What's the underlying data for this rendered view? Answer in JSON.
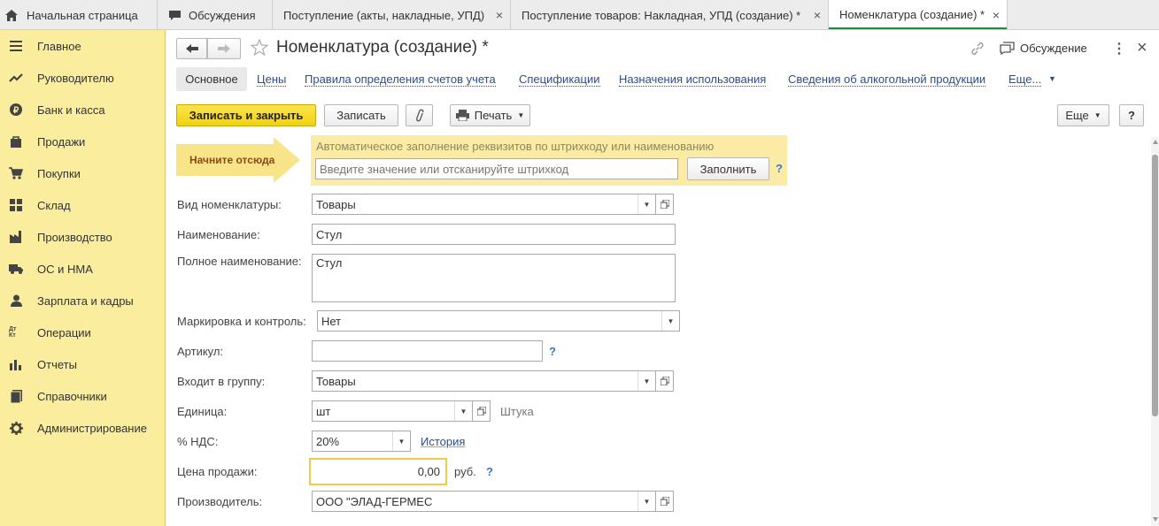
{
  "tabs": [
    {
      "label": "Начальная страница",
      "icon": "home-icon"
    },
    {
      "label": "Обсуждения",
      "icon": "chat-icon"
    },
    {
      "label": "Поступление (акты, накладные, УПД)",
      "close": "×"
    },
    {
      "label": "Поступление товаров: Накладная, УПД (создание) *",
      "close": "×"
    },
    {
      "label": "Номенклатура (создание) *",
      "close": "×"
    }
  ],
  "sidebar": {
    "items": [
      {
        "label": "Главное",
        "icon": "menu-icon"
      },
      {
        "label": "Руководителю",
        "icon": "trend-icon"
      },
      {
        "label": "Банк и касса",
        "icon": "coin-icon"
      },
      {
        "label": "Продажи",
        "icon": "bag-icon"
      },
      {
        "label": "Покупки",
        "icon": "cart-icon"
      },
      {
        "label": "Склад",
        "icon": "grid-icon"
      },
      {
        "label": "Производство",
        "icon": "factory-icon"
      },
      {
        "label": "ОС и НМА",
        "icon": "truck-icon"
      },
      {
        "label": "Зарплата и кадры",
        "icon": "person-icon"
      },
      {
        "label": "Операции",
        "icon": "dt-kt-icon",
        "glyph": "Дт Кт"
      },
      {
        "label": "Отчеты",
        "icon": "bar-chart-icon"
      },
      {
        "label": "Справочники",
        "icon": "book-icon"
      },
      {
        "label": "Администрирование",
        "icon": "gear-icon"
      }
    ]
  },
  "header": {
    "title": "Номенклатура (создание) *",
    "discussion": "Обсуждение",
    "more": "⋮",
    "close": "×"
  },
  "nav": {
    "main": "Основное",
    "links": [
      "Цены",
      "Правила определения счетов учета",
      "Спецификации",
      "Назначения использования",
      "Сведения об алкогольной продукции",
      "Еще..."
    ]
  },
  "toolbar": {
    "save_close": "Записать и закрыть",
    "save": "Записать",
    "print": "Печать",
    "more": "Еще",
    "help": "?"
  },
  "autofill": {
    "start_label": "Начните отсюда",
    "title": "Автоматическое заполнение реквизитов по штрихкоду или наименованию",
    "placeholder": "Введите значение или отсканируйте штрихкод",
    "fill_button": "Заполнить",
    "help": "?"
  },
  "form": {
    "kind_label": "Вид номенклатуры:",
    "kind_value": "Товары",
    "name_label": "Наименование:",
    "name_value": "Стул",
    "full_name_label": "Полное наименование:",
    "full_name_value": "Стул",
    "marking_label": "Маркировка и контроль:",
    "marking_value": "Нет",
    "article_label": "Артикул:",
    "article_value": "",
    "article_help": "?",
    "group_label": "Входит в группу:",
    "group_value": "Товары",
    "unit_label": "Единица:",
    "unit_value": "шт",
    "unit_full": "Штука",
    "vat_label": "% НДС:",
    "vat_value": "20%",
    "vat_history": "История",
    "price_label": "Цена продажи:",
    "price_value": "0,00",
    "price_currency": "руб.",
    "price_help": "?",
    "maker_label": "Производитель:",
    "maker_value": "ООО \"ЭЛАД-ГЕРМЕС"
  },
  "colors": {
    "sidebar_bg": "#fbed9e",
    "primary_button": "#f5d91f",
    "active_tab_underline": "#1f8a3a",
    "link": "#2a4f8a",
    "autofill_bg": "#fbeba5"
  }
}
